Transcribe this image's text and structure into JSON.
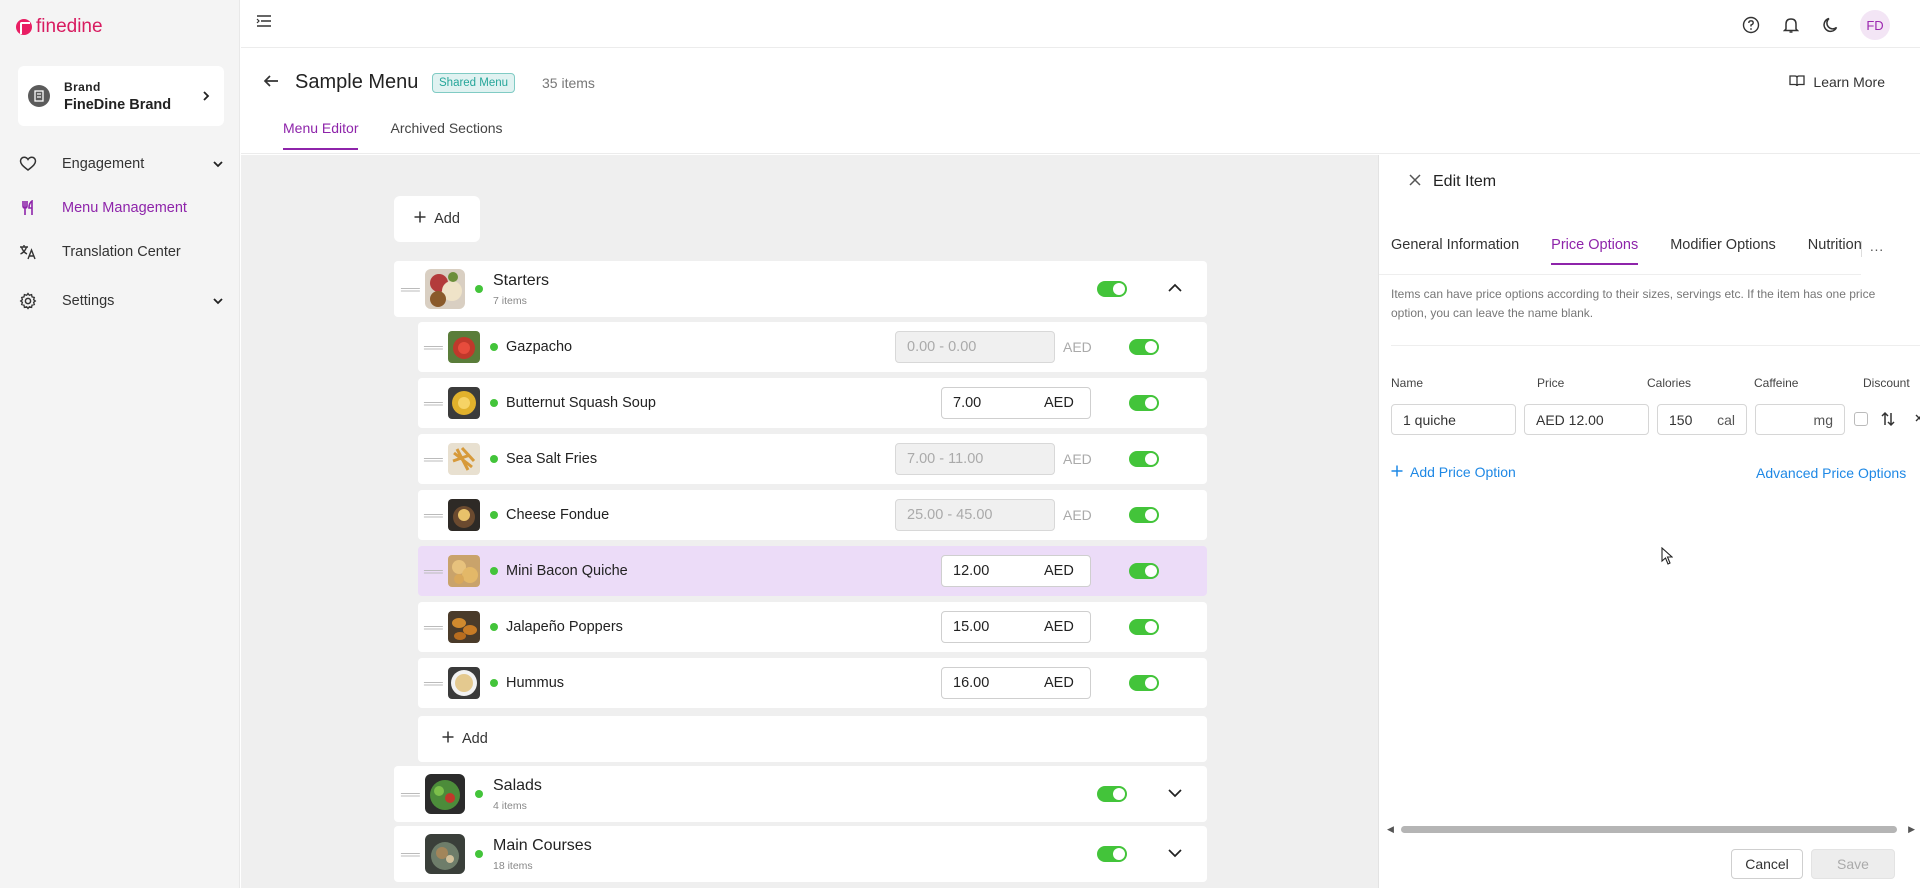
{
  "app": {
    "logo_text": "finedine",
    "brand_color": "#e91e63"
  },
  "sidebar": {
    "brand_label": "Brand",
    "brand_name": "FineDine Brand",
    "items": [
      {
        "label": "Engagement",
        "icon": "heart-icon",
        "expandable": true
      },
      {
        "label": "Menu Management",
        "icon": "fork-knife-icon",
        "active": true
      },
      {
        "label": "Translation Center",
        "icon": "translate-icon"
      },
      {
        "label": "Settings",
        "icon": "gear-icon",
        "expandable": true
      }
    ]
  },
  "topbar": {
    "avatar_initials": "FD",
    "icons": [
      "help-icon",
      "bell-icon",
      "moon-icon"
    ]
  },
  "header": {
    "title": "Sample Menu",
    "badge": "Shared Menu",
    "items_count": "35 items",
    "learn_more": "Learn More",
    "tabs": [
      {
        "label": "Menu Editor",
        "active": true
      },
      {
        "label": "Archived Sections"
      }
    ]
  },
  "editor": {
    "add_label": "Add",
    "sections": [
      {
        "name": "Starters",
        "count": "7 items",
        "expanded": true,
        "items": [
          {
            "name": "Gazpacho",
            "price": "0.00 - 0.00",
            "currency": "AED",
            "range": true
          },
          {
            "name": "Butternut Squash Soup",
            "price": "7.00",
            "currency": "AED",
            "range": false
          },
          {
            "name": "Sea Salt Fries",
            "price": "7.00 - 11.00",
            "currency": "AED",
            "range": true
          },
          {
            "name": "Cheese Fondue",
            "price": "25.00 - 45.00",
            "currency": "AED",
            "range": true
          },
          {
            "name": "Mini Bacon Quiche",
            "price": "12.00",
            "currency": "AED",
            "range": false,
            "selected": true
          },
          {
            "name": "Jalapeño Poppers",
            "price": "15.00",
            "currency": "AED",
            "range": false
          },
          {
            "name": "Hummus",
            "price": "16.00",
            "currency": "AED",
            "range": false
          }
        ],
        "add_item_label": "Add"
      },
      {
        "name": "Salads",
        "count": "4 items",
        "expanded": false
      },
      {
        "name": "Main Courses",
        "count": "18 items",
        "expanded": false
      }
    ]
  },
  "panel": {
    "title": "Edit Item",
    "tabs": [
      {
        "label": "General Information"
      },
      {
        "label": "Price Options",
        "active": true
      },
      {
        "label": "Modifier Options"
      },
      {
        "label": "Nutrition I"
      }
    ],
    "more": "···",
    "description": "Items can have price options according to their sizes, servings etc. If the item has one price option, you can leave the name blank.",
    "columns": {
      "name": "Name",
      "price": "Price",
      "calories": "Calories",
      "caffeine": "Caffeine",
      "discount": "Discount"
    },
    "row": {
      "name": "1 quiche",
      "price": "AED 12.00",
      "calories": "150",
      "calories_unit": "cal",
      "caffeine": "",
      "caffeine_unit": "mg"
    },
    "add_price_option": "Add Price Option",
    "advanced_price_options": "Advanced Price Options",
    "cancel": "Cancel",
    "save": "Save"
  },
  "colors": {
    "accent": "#8e24aa",
    "toggle_on": "#43c43a",
    "link": "#1e88e5",
    "selected_row": "#ecdcf8"
  }
}
